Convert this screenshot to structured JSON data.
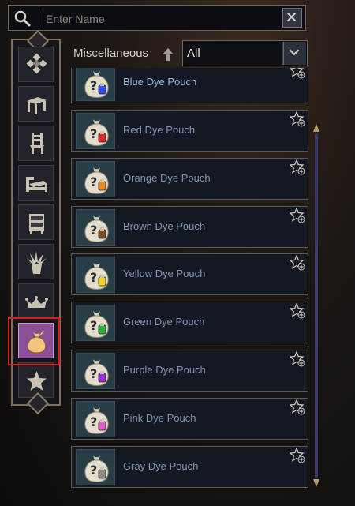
{
  "search": {
    "placeholder": "Enter Name",
    "value": ""
  },
  "header": {
    "category_title": "Miscellaneous",
    "filter_value": "All"
  },
  "categories": [
    {
      "icon": "diamond-pattern-icon"
    },
    {
      "icon": "table-icon"
    },
    {
      "icon": "chair-icon"
    },
    {
      "icon": "bed-icon"
    },
    {
      "icon": "cabinet-icon"
    },
    {
      "icon": "plant-icon"
    },
    {
      "icon": "crown-tray-icon"
    },
    {
      "icon": "pouch-icon",
      "active": true
    },
    {
      "icon": "star-icon"
    }
  ],
  "items": [
    {
      "name": "Blue Dye Pouch",
      "color": "#2f4dff"
    },
    {
      "name": "Red Dye Pouch",
      "color": "#e0262a"
    },
    {
      "name": "Orange Dye Pouch",
      "color": "#ef8a1e"
    },
    {
      "name": "Brown Dye Pouch",
      "color": "#7a4a22"
    },
    {
      "name": "Yellow Dye Pouch",
      "color": "#f2d51e"
    },
    {
      "name": "Green Dye Pouch",
      "color": "#27b13a"
    },
    {
      "name": "Purple Dye Pouch",
      "color": "#9a2ad6"
    },
    {
      "name": "Pink Dye Pouch",
      "color": "#e05cc8"
    },
    {
      "name": "Gray Dye Pouch",
      "color": "#8a8a8a"
    }
  ],
  "colors": {
    "accent_active": "#8a4f96",
    "highlight": "#e01b1b",
    "item_text": "#7f94b2"
  }
}
